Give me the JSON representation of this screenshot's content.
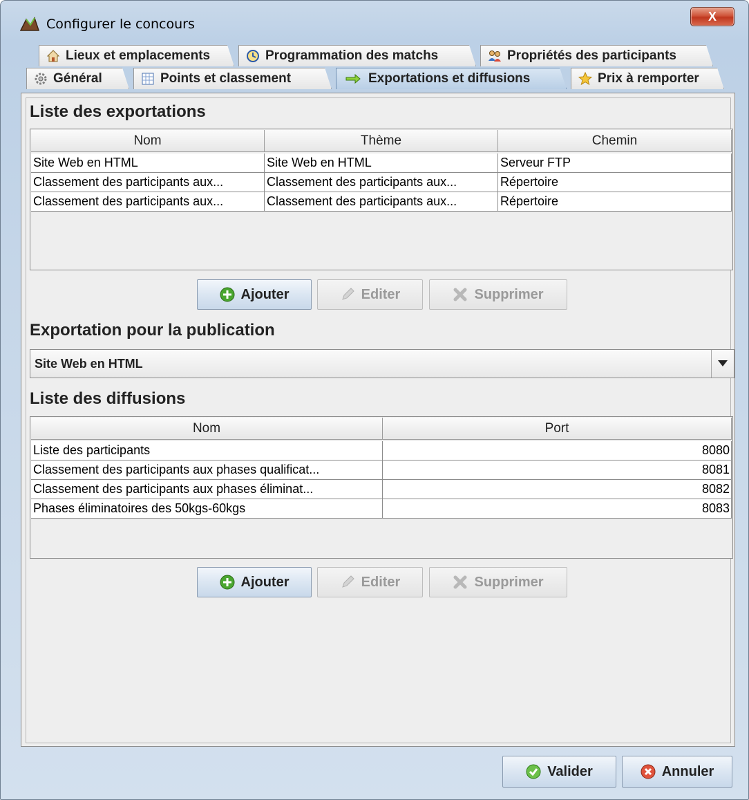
{
  "window": {
    "title": "Configurer le concours",
    "close_label": "X"
  },
  "tabs": {
    "row1": [
      {
        "label": "Lieux et emplacements",
        "icon": "house-icon"
      },
      {
        "label": "Programmation des matchs",
        "icon": "clock-icon"
      },
      {
        "label": "Propriétés des participants",
        "icon": "users-icon"
      }
    ],
    "row2": [
      {
        "label": "Général",
        "icon": "gear-icon"
      },
      {
        "label": "Points et classement",
        "icon": "table-icon"
      },
      {
        "label": "Exportations et diffusions",
        "icon": "arrow-right-icon",
        "active": true
      },
      {
        "label": "Prix à remporter",
        "icon": "star-icon"
      }
    ]
  },
  "exports": {
    "title": "Liste des exportations",
    "columns": [
      "Nom",
      "Thème",
      "Chemin"
    ],
    "rows": [
      [
        "Site Web en HTML",
        "Site Web en HTML",
        "Serveur FTP"
      ],
      [
        "Classement des participants aux...",
        "Classement des participants aux...",
        "Répertoire"
      ],
      [
        "Classement des participants aux...",
        "Classement des participants aux...",
        "Répertoire"
      ]
    ],
    "buttons": {
      "add": "Ajouter",
      "edit": "Editer",
      "delete": "Supprimer"
    }
  },
  "publication": {
    "title": "Exportation pour la publication",
    "selected": "Site Web en HTML"
  },
  "diffusions": {
    "title": "Liste des diffusions",
    "columns": [
      "Nom",
      "Port"
    ],
    "rows": [
      [
        "Liste des participants",
        "8080"
      ],
      [
        "Classement des participants aux phases qualificat...",
        "8081"
      ],
      [
        "Classement des participants aux phases éliminat...",
        "8082"
      ],
      [
        "Phases éliminatoires des 50kgs-60kgs",
        "8083"
      ]
    ],
    "buttons": {
      "add": "Ajouter",
      "edit": "Editer",
      "delete": "Supprimer"
    }
  },
  "footer": {
    "validate": "Valider",
    "cancel": "Annuler"
  },
  "colors": {
    "accent": "#4aa630",
    "danger": "#d9534f",
    "tab_active": "#b9cfe6"
  }
}
